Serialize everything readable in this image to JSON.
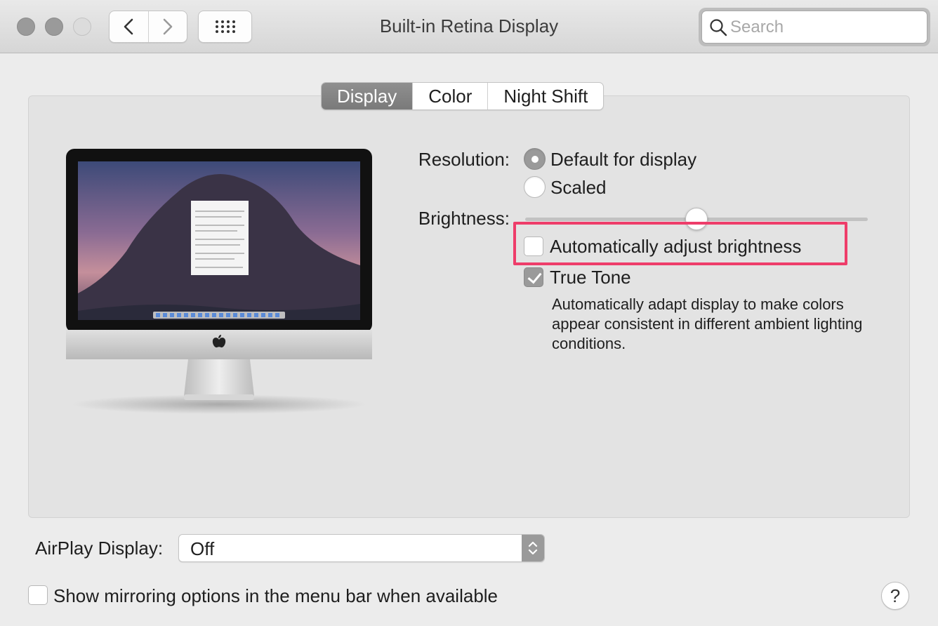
{
  "window": {
    "title": "Built-in Retina Display"
  },
  "toolbar": {
    "back_icon": "chevron-left-icon",
    "forward_icon": "chevron-right-icon",
    "show_all_icon": "grid-icon"
  },
  "search": {
    "placeholder": "Search",
    "value": ""
  },
  "tabs": [
    {
      "label": "Display",
      "active": true
    },
    {
      "label": "Color",
      "active": false
    },
    {
      "label": "Night Shift",
      "active": false
    }
  ],
  "display": {
    "resolution_label": "Resolution:",
    "resolution_options": [
      {
        "label": "Default for display",
        "selected": true
      },
      {
        "label": "Scaled",
        "selected": false
      }
    ],
    "brightness_label": "Brightness:",
    "brightness_level": 0.5,
    "auto_brightness": {
      "label": "Automatically adjust brightness",
      "checked": false
    },
    "true_tone": {
      "label": "True Tone",
      "checked": true
    },
    "true_tone_description": "Automatically adapt display to make colors appear consistent in different ambient lighting conditions."
  },
  "airplay": {
    "label": "AirPlay Display:",
    "value": "Off"
  },
  "mirroring": {
    "label": "Show mirroring options in the menu bar when available",
    "checked": false
  },
  "help": {
    "label": "?"
  },
  "colors": {
    "highlight": "#ee3d6a",
    "selected_control": "#9a9a9a"
  }
}
